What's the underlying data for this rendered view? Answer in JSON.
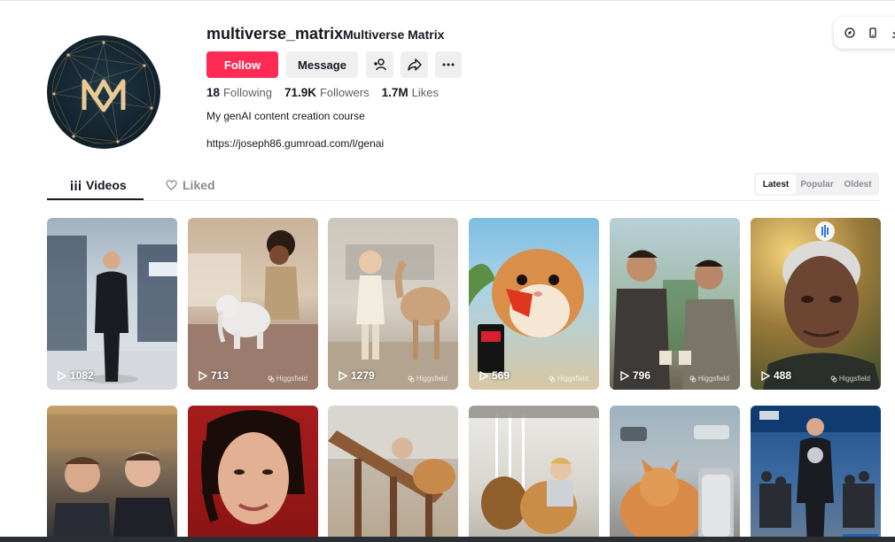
{
  "profile": {
    "username": "multiverse_matrix",
    "nickname": "Multiverse Matrix",
    "follow_label": "Follow",
    "message_label": "Message",
    "stats": [
      {
        "value": "18",
        "label": "Following"
      },
      {
        "value": "71.9K",
        "label": "Followers"
      },
      {
        "value": "1.7M",
        "label": "Likes"
      }
    ],
    "bio": "My genAI content creation course",
    "link": "https://joseph86.gumroad.com/l/genai"
  },
  "tabs": {
    "videos": "Videos",
    "liked": "Liked"
  },
  "sort": {
    "options": [
      "Latest",
      "Popular",
      "Oldest"
    ],
    "selected": "Latest"
  },
  "videos": [
    {
      "views": "1082",
      "watermark": ""
    },
    {
      "views": "713",
      "watermark": "Higgsfield"
    },
    {
      "views": "1279",
      "watermark": "Higgsfield"
    },
    {
      "views": "569",
      "watermark": "Higgsfield"
    },
    {
      "views": "796",
      "watermark": "Higgsfield"
    },
    {
      "views": "488",
      "watermark": "Higgsfield"
    },
    {
      "views": "",
      "watermark": ""
    },
    {
      "views": "",
      "watermark": ""
    },
    {
      "views": "",
      "watermark": ""
    },
    {
      "views": "",
      "watermark": ""
    },
    {
      "views": "",
      "watermark": ""
    },
    {
      "views": "",
      "watermark": ""
    }
  ],
  "colors": {
    "accent": "#fe2c55",
    "text_primary": "#161823",
    "text_secondary": "#5f6068",
    "button_bg": "#efefef"
  },
  "icons": {
    "add_user": "add-user-icon",
    "share": "share-icon",
    "more": "more-icon",
    "videos_tab": "grid-icon",
    "liked_tab": "heart-icon",
    "play": "play-icon",
    "watermark": "link-icon",
    "toolbar": [
      "compass-icon",
      "phone-icon",
      "download-icon"
    ]
  }
}
